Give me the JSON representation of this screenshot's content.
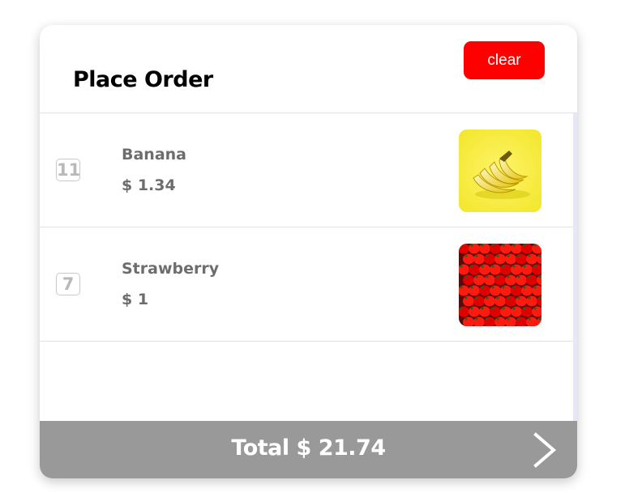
{
  "order": {
    "title": "Place Order",
    "clear_label": "clear",
    "items": [
      {
        "quantity": "11",
        "name": "Banana",
        "price": "$ 1.34",
        "image_icon": "banana-image"
      },
      {
        "quantity": "7",
        "name": "Strawberry",
        "price": "$ 1",
        "image_icon": "strawberry-image"
      }
    ],
    "total_label": "Total $ 21.74",
    "next_icon": "chevron-right-icon"
  },
  "colors": {
    "clear_button": "#ff0000",
    "footer": "#999999",
    "text_muted": "#6d6d6d"
  }
}
